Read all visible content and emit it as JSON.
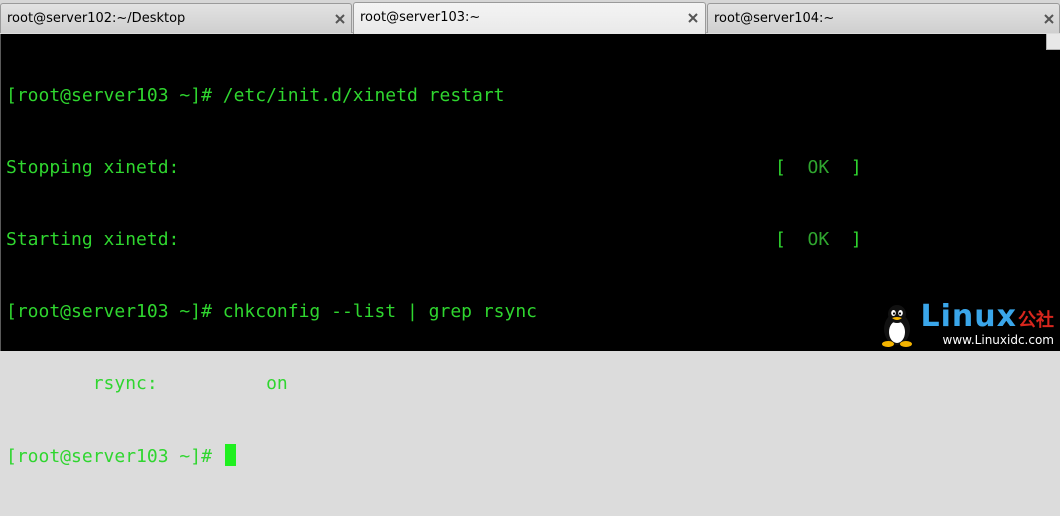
{
  "tabs": [
    {
      "label": "root@server102:~/Desktop",
      "active": false
    },
    {
      "label": "root@server103:~",
      "active": true
    },
    {
      "label": "root@server104:~",
      "active": false
    }
  ],
  "terminal": {
    "lines": [
      {
        "text": "[root@server103 ~]# /etc/init.d/xinetd restart"
      },
      {
        "text": "Stopping xinetd:",
        "status_open": "[  ",
        "status": "OK",
        "status_close": "  ]"
      },
      {
        "text": "Starting xinetd:",
        "status_open": "[  ",
        "status": "OK",
        "status_close": "  ]"
      },
      {
        "text": "[root@server103 ~]# chkconfig --list | grep rsync"
      },
      {
        "text": "        rsync:          on"
      },
      {
        "text": "[root@server103 ~]# "
      }
    ]
  },
  "watermark": {
    "brand": "Linux",
    "brand_cn": "公社",
    "url": "www.Linuxidc.com"
  },
  "colors": {
    "terminal_fg": "#2fd62f",
    "terminal_bg": "#000000",
    "cursor": "#20f020",
    "watermark_blue": "#3aa6ea",
    "watermark_red": "#d8261d"
  }
}
